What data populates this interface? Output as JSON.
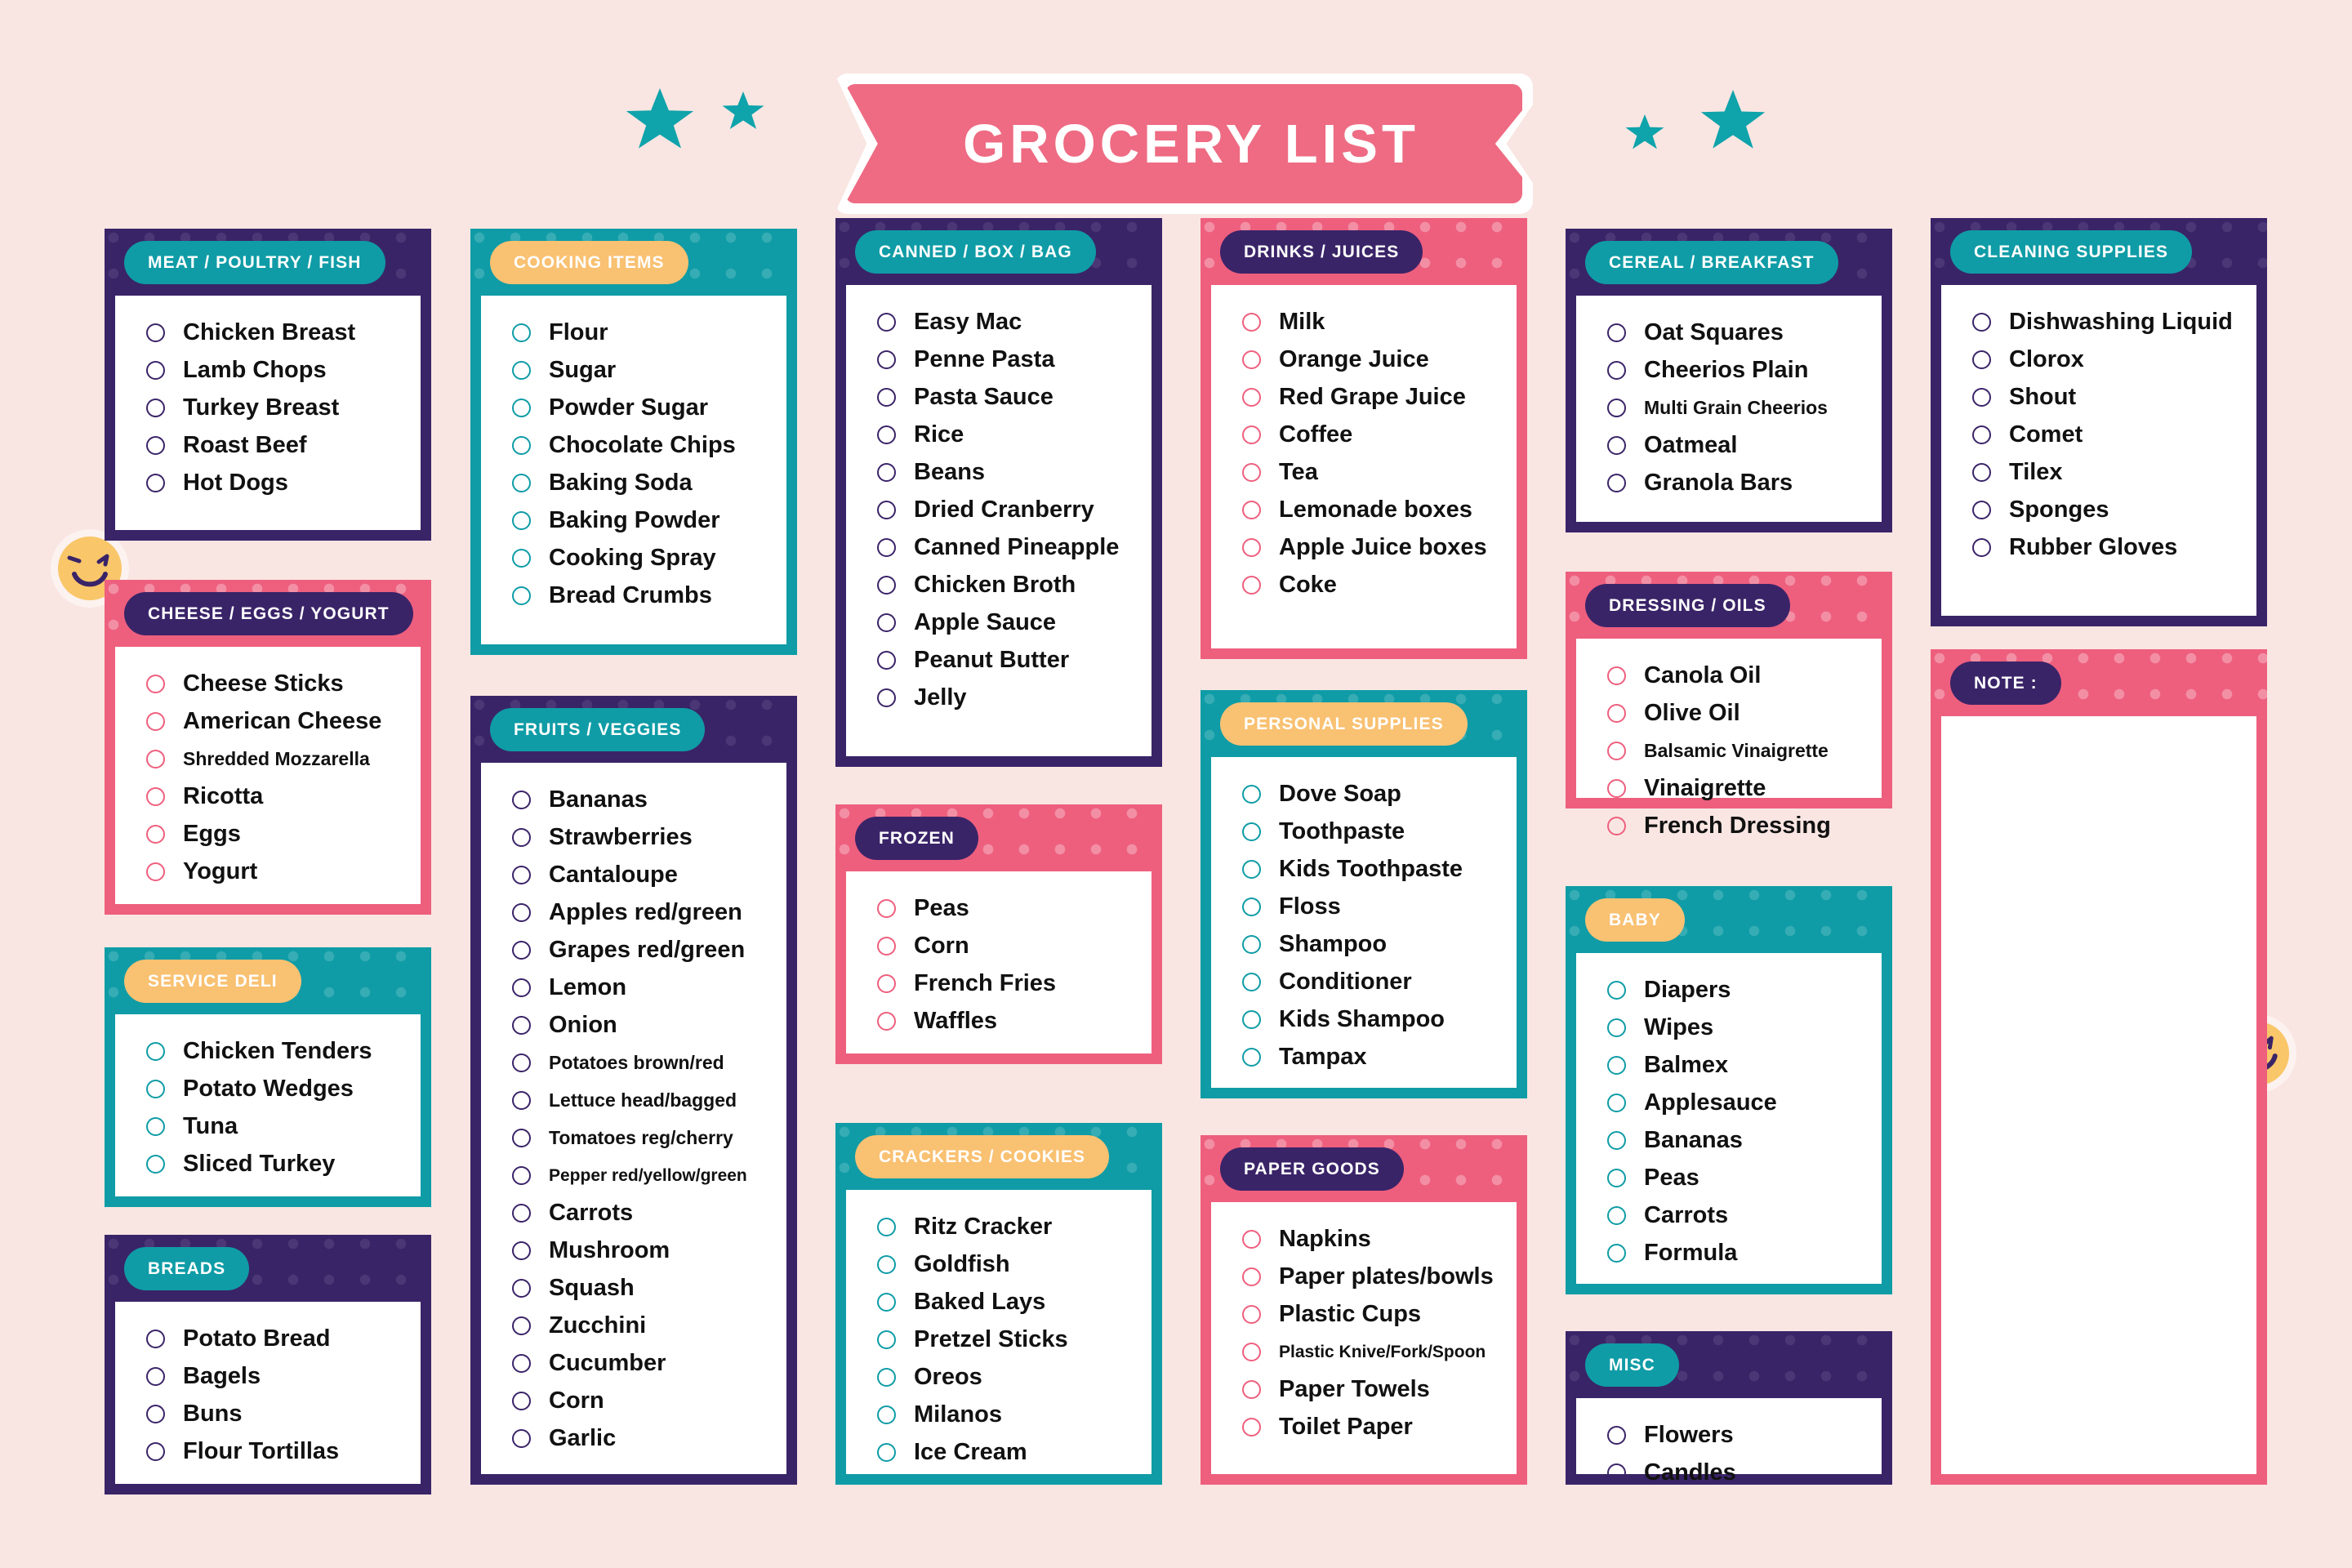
{
  "header": {
    "title": "GROCERY LIST",
    "decorations": [
      "star-icon",
      "star-icon",
      "star-icon",
      "star-icon"
    ]
  },
  "colors": {
    "background": "#F9E6E2",
    "purple": "#3A2468",
    "teal": "#0F9CA6",
    "pink": "#EE5F7E",
    "yellow": "#F9C172",
    "banner_pink": "#EE6B83",
    "white": "#FFFFFF"
  },
  "emojis": [
    {
      "name": "winking-face-left"
    },
    {
      "name": "winking-face-right"
    }
  ],
  "columns": [
    {
      "cards": [
        {
          "title": "MEAT / POULTRY / FISH",
          "card_color": "purple",
          "pill_color": "teal",
          "items": [
            "Chicken Breast",
            "Lamb Chops",
            "Turkey Breast",
            "Roast Beef",
            "Hot Dogs"
          ]
        },
        {
          "title": "CHEESE / EGGS / YOGURT",
          "card_color": "pink",
          "pill_color": "purple",
          "items": [
            "Cheese Sticks",
            "American Cheese",
            "Shredded Mozzarella",
            "Ricotta",
            "Eggs",
            "Yogurt"
          ],
          "small_items": [
            "Shredded Mozzarella"
          ]
        },
        {
          "title": "SERVICE DELI",
          "card_color": "teal",
          "pill_color": "yellow",
          "items": [
            "Chicken Tenders",
            "Potato Wedges",
            "Tuna",
            "Sliced Turkey"
          ]
        },
        {
          "title": "BREADS",
          "card_color": "purple",
          "pill_color": "teal",
          "items": [
            "Potato Bread",
            "Bagels",
            "Buns",
            "Flour Tortillas"
          ]
        }
      ]
    },
    {
      "cards": [
        {
          "title": "COOKING ITEMS",
          "card_color": "teal",
          "pill_color": "yellow",
          "items": [
            "Flour",
            "Sugar",
            "Powder Sugar",
            "Chocolate Chips",
            "Baking Soda",
            "Baking Powder",
            "Cooking Spray",
            "Bread Crumbs"
          ]
        },
        {
          "title": "FRUITS / VEGGIES",
          "card_color": "purple",
          "pill_color": "teal",
          "items": [
            "Bananas",
            "Strawberries",
            "Cantaloupe",
            "Apples red/green",
            "Grapes red/green",
            "Lemon",
            "Onion",
            "Potatoes brown/red",
            "Lettuce head/bagged",
            "Tomatoes reg/cherry",
            "Pepper red/yellow/green",
            "Carrots",
            "Mushroom",
            "Squash",
            "Zucchini",
            "Cucumber",
            "Corn",
            "Garlic"
          ],
          "small_items": [
            "Potatoes brown/red",
            "Lettuce head/bagged",
            "Tomatoes reg/cherry"
          ],
          "xsmall_items": [
            "Pepper red/yellow/green"
          ]
        }
      ]
    },
    {
      "cards": [
        {
          "title": "CANNED / BOX / BAG",
          "card_color": "purple",
          "pill_color": "teal",
          "items": [
            "Easy Mac",
            "Penne Pasta",
            "Pasta Sauce",
            "Rice",
            "Beans",
            "Dried Cranberry",
            "Canned Pineapple",
            "Chicken Broth",
            "Apple Sauce",
            "Peanut Butter",
            "Jelly"
          ]
        },
        {
          "title": "FROZEN",
          "card_color": "pink",
          "pill_color": "purple",
          "items": [
            "Peas",
            "Corn",
            "French Fries",
            "Waffles"
          ]
        },
        {
          "title": "CRACKERS / COOKIES",
          "card_color": "teal",
          "pill_color": "yellow",
          "items": [
            "Ritz Cracker",
            "Goldfish",
            "Baked Lays",
            "Pretzel Sticks",
            "Oreos",
            "Milanos",
            "Ice Cream"
          ]
        }
      ]
    },
    {
      "cards": [
        {
          "title": "DRINKS / JUICES",
          "card_color": "pink",
          "pill_color": "purple",
          "items": [
            "Milk",
            "Orange Juice",
            "Red Grape Juice",
            "Coffee",
            "Tea",
            "Lemonade boxes",
            "Apple Juice boxes",
            "Coke"
          ]
        },
        {
          "title": "PERSONAL SUPPLIES",
          "card_color": "teal",
          "pill_color": "yellow",
          "items": [
            "Dove Soap",
            "Toothpaste",
            "Kids Toothpaste",
            "Floss",
            "Shampoo",
            "Conditioner",
            "Kids Shampoo",
            "Tampax"
          ]
        },
        {
          "title": "PAPER GOODS",
          "card_color": "pink",
          "pill_color": "purple",
          "items": [
            "Napkins",
            "Paper plates/bowls",
            "Plastic Cups",
            "Plastic Knive/Fork/Spoon",
            "Paper Towels",
            "Toilet Paper"
          ],
          "xsmall_items": [
            "Plastic Knive/Fork/Spoon"
          ]
        }
      ]
    },
    {
      "cards": [
        {
          "title": "CEREAL / BREAKFAST",
          "card_color": "purple",
          "pill_color": "teal",
          "items": [
            "Oat Squares",
            "Cheerios Plain",
            "Multi Grain Cheerios",
            "Oatmeal",
            "Granola Bars"
          ],
          "small_items": [
            "Multi Grain Cheerios"
          ]
        },
        {
          "title": "DRESSING / OILS",
          "card_color": "pink",
          "pill_color": "purple",
          "items": [
            "Canola Oil",
            "Olive Oil",
            "Balsamic Vinaigrette",
            "Vinaigrette",
            "French Dressing"
          ],
          "small_items": [
            "Balsamic Vinaigrette"
          ]
        },
        {
          "title": "BABY",
          "card_color": "teal",
          "pill_color": "yellow",
          "items": [
            "Diapers",
            "Wipes",
            "Balmex",
            "Applesauce",
            "Bananas",
            "Peas",
            "Carrots",
            "Formula"
          ]
        },
        {
          "title": "MISC",
          "card_color": "purple",
          "pill_color": "teal",
          "items": [
            "Flowers",
            "Candles"
          ]
        }
      ]
    },
    {
      "cards": [
        {
          "title": "CLEANING SUPPLIES",
          "card_color": "purple",
          "pill_color": "teal",
          "items": [
            "Dishwashing Liquid",
            "Clorox",
            "Shout",
            "Comet",
            "Tilex",
            "Sponges",
            "Rubber Gloves"
          ]
        },
        {
          "title": "NOTE :",
          "card_color": "pink",
          "pill_color": "purple",
          "items": [],
          "is_note": true
        }
      ]
    }
  ]
}
